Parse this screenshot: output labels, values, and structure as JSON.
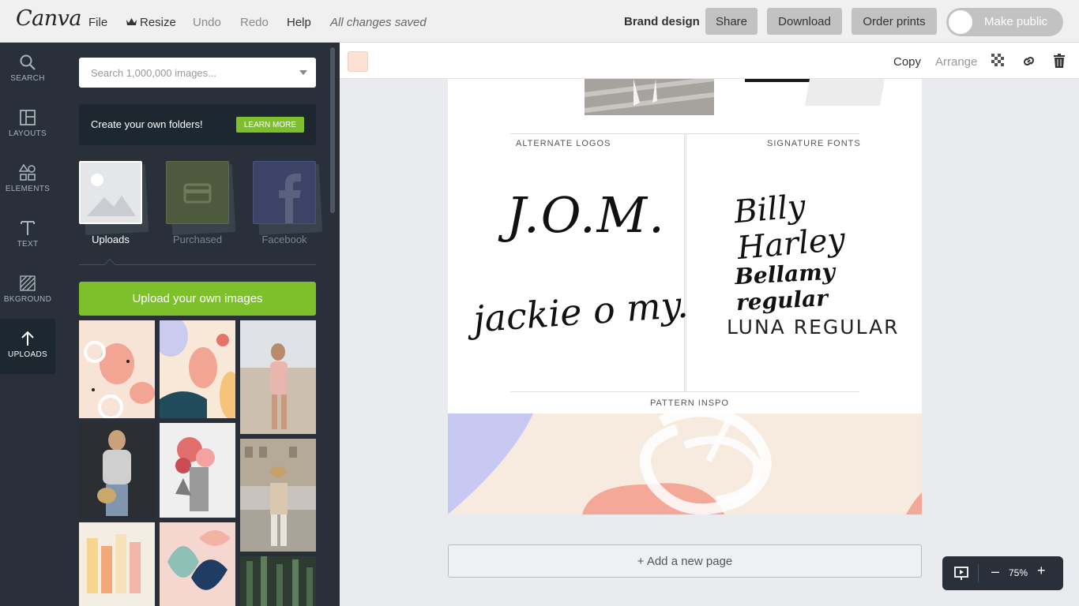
{
  "app": {
    "logo": "Canva"
  },
  "menu": {
    "file": "File",
    "resize": "Resize",
    "undo": "Undo",
    "redo": "Redo",
    "help": "Help",
    "status": "All changes saved"
  },
  "header": {
    "brand": "Brand design",
    "share": "Share",
    "download": "Download",
    "order": "Order prints",
    "make_public": "Make public"
  },
  "nav": [
    {
      "label": "SEARCH",
      "icon": "search-icon"
    },
    {
      "label": "LAYOUTS",
      "icon": "layouts-icon"
    },
    {
      "label": "ELEMENTS",
      "icon": "elements-icon"
    },
    {
      "label": "TEXT",
      "icon": "text-icon"
    },
    {
      "label": "BKGROUND",
      "icon": "background-icon"
    },
    {
      "label": "UPLOADS",
      "icon": "upload-arrow-icon"
    }
  ],
  "panel": {
    "search_placeholder": "Search 1,000,000 images...",
    "promo_text": "Create your own folders!",
    "learn_more": "LEARN MORE",
    "folders": [
      {
        "label": "Uploads",
        "icon": "image-icon"
      },
      {
        "label": "Purchased",
        "icon": "credit-card-icon"
      },
      {
        "label": "Facebook",
        "icon": "facebook-icon"
      }
    ],
    "upload_button": "Upload your own images"
  },
  "toolbar": {
    "copy": "Copy",
    "arrange": "Arrange"
  },
  "canvas": {
    "alternate_logos": "ALTERNATE LOGOS",
    "signature_fonts": "SIGNATURE FONTS",
    "logo_1": "J.O.M.",
    "logo_2": "jackie o my.",
    "font_1": "Billy Harley",
    "font_2": "Bellamy regular",
    "font_3": "LUNA REGULAR",
    "pattern_inspo": "PATTERN INSPO"
  },
  "add_page": "+ Add a new page",
  "zoom": {
    "minus": "–",
    "value": "75%",
    "plus": "+"
  },
  "colors": {
    "accent_green": "#7dc02c",
    "nav_bg": "#1d2730",
    "panel_bg": "#293039",
    "swatch": "#fde1d3"
  }
}
